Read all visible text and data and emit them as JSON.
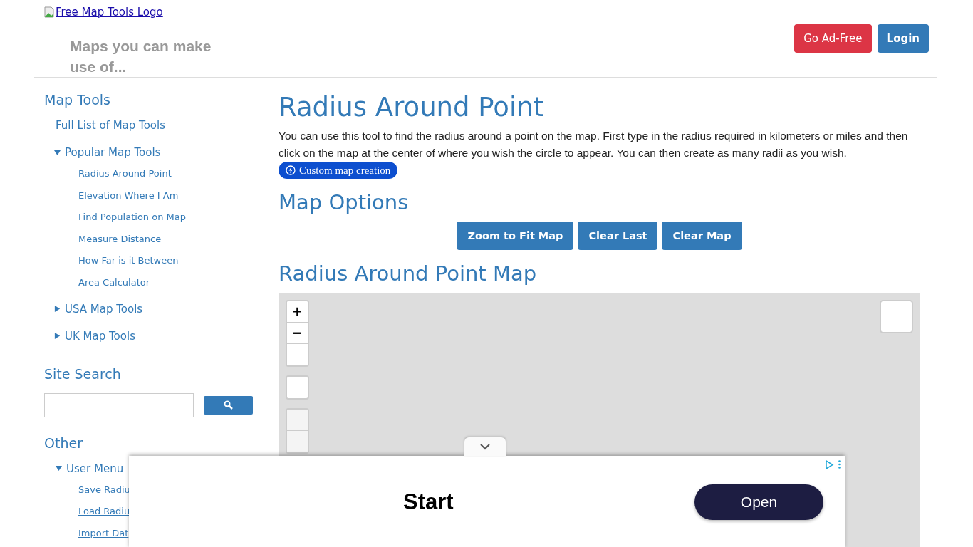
{
  "header": {
    "logo_alt": "Free Map Tools Logo",
    "tagline": "Maps you can make use of...",
    "buttons": [
      {
        "label": "Go Ad-Free",
        "kind": "danger"
      },
      {
        "label": "Login",
        "kind": "primary"
      }
    ]
  },
  "sidebar": {
    "map_tools": {
      "title": "Map Tools",
      "items": [
        {
          "label": "Full List of Map Tools"
        },
        {
          "label": "Popular Map Tools",
          "expanded": true,
          "children": [
            {
              "label": "Radius Around Point"
            },
            {
              "label": "Elevation Where I Am"
            },
            {
              "label": "Find Population on Map"
            },
            {
              "label": "Measure Distance"
            },
            {
              "label": "How Far is it Between"
            },
            {
              "label": "Area Calculator"
            }
          ]
        },
        {
          "label": "USA Map Tools",
          "expanded": false
        },
        {
          "label": "UK Map Tools",
          "expanded": false
        }
      ]
    },
    "site_search": {
      "title": "Site Search"
    },
    "other": {
      "title": "Other",
      "items": [
        {
          "label": "User Menu",
          "expanded": true,
          "children": [
            {
              "label": "Save Radiu"
            },
            {
              "label": "Load Radiu"
            },
            {
              "label": "Import Dat"
            }
          ]
        }
      ]
    }
  },
  "main": {
    "title": "Radius Around Point",
    "description": "You can use this tool to find the radius around a point on the map. First type in the radius required in kilometers or miles and then click on the map at the center of where you wish the circle to appear. You can then create as many radii as you wish.",
    "badge": "Custom map creation",
    "options_heading": "Map Options",
    "option_buttons": [
      "Zoom to Fit Map",
      "Clear Last",
      "Clear Map"
    ],
    "map_heading": "Radius Around Point Map",
    "map": {
      "zoom_in": "+",
      "zoom_out": "−"
    }
  },
  "ad": {
    "headline": "Start",
    "button": "Open"
  }
}
